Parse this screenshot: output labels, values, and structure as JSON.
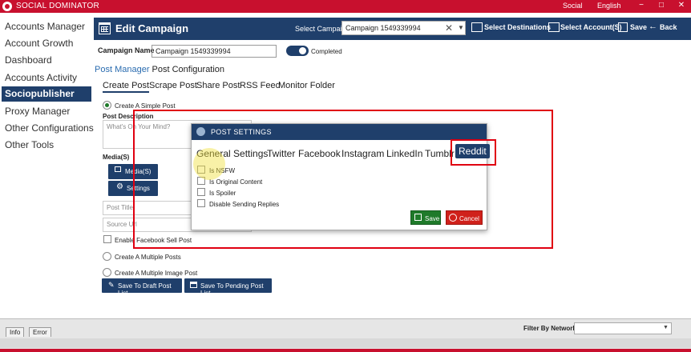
{
  "app": {
    "title": "SOCIAL DOMINATOR",
    "social_label": "Social",
    "language": "English",
    "win_min": "−",
    "win_max": "□",
    "win_close": "✕"
  },
  "sidebar": {
    "items": [
      {
        "label": "Accounts Manager"
      },
      {
        "label": "Account Growth"
      },
      {
        "label": "Dashboard"
      },
      {
        "label": "Accounts Activity"
      },
      {
        "label": "Sociopublisher"
      },
      {
        "label": "Proxy Manager"
      },
      {
        "label": "Other Configurations"
      },
      {
        "label": "Other Tools"
      }
    ],
    "active_index": 4
  },
  "header": {
    "title": "Edit Campaign",
    "select_campaign_label": "Select Campaign",
    "select_campaign_value": "Campaign 1549339994",
    "clear_glyph": "✕",
    "dropdown_glyph": "▼",
    "select_destinations": "Select Destinations",
    "select_accounts": "Select Account(S)",
    "save": "Save",
    "back": "Back",
    "back_glyph": "←"
  },
  "campaign": {
    "name_label": "Campaign Name",
    "name_value": "Campaign 1549339994",
    "status_label": "Completed",
    "status_on": true
  },
  "breadcrumb": {
    "link": "Post Manager",
    "current": "Post Configuration"
  },
  "tabs": [
    "Create Post",
    "Scrape Post",
    "Share Post",
    "RSS Feed",
    "Monitor Folder"
  ],
  "form": {
    "single_post": "Create A Simple Post",
    "post_description_label": "Post Description",
    "post_description_placeholder": "What's On Your Mind?",
    "media_label": "Media(S)",
    "media_button": "Media(S)",
    "settings_button": "Settings",
    "post_title_placeholder": "Post Title",
    "source_url_placeholder": "Source Url",
    "facebook_sell": "Enable Facebook Sell Post",
    "multiple_posts": "Create A Multiple Posts",
    "multiple_image": "Create A Multiple Image Post",
    "save_draft": "Save To Draft Post List",
    "save_pending": "Save To Pending Post List"
  },
  "modal": {
    "title": "POST SETTINGS",
    "tabs": [
      "General Settings",
      "Twitter",
      "Facebook",
      "Instagram",
      "LinkedIn",
      "Tumblr",
      "Reddit"
    ],
    "active_tab": "Reddit",
    "options": [
      "Is NSFW",
      "Is Original Content",
      "Is Spoiler",
      "Disable Sending Replies"
    ],
    "save": "Save",
    "cancel": "Cancel"
  },
  "bottom": {
    "tabs": [
      "Info",
      "Error"
    ],
    "filter_label": "Filter By Network",
    "filter_value": "",
    "dropdown_glyph": "▼"
  },
  "colors": {
    "brand_red": "#c8102e",
    "navy": "#1f3f6b",
    "save_green": "#1f7a2a",
    "cancel_red": "#d0211b",
    "highlight_red": "#e00010"
  }
}
